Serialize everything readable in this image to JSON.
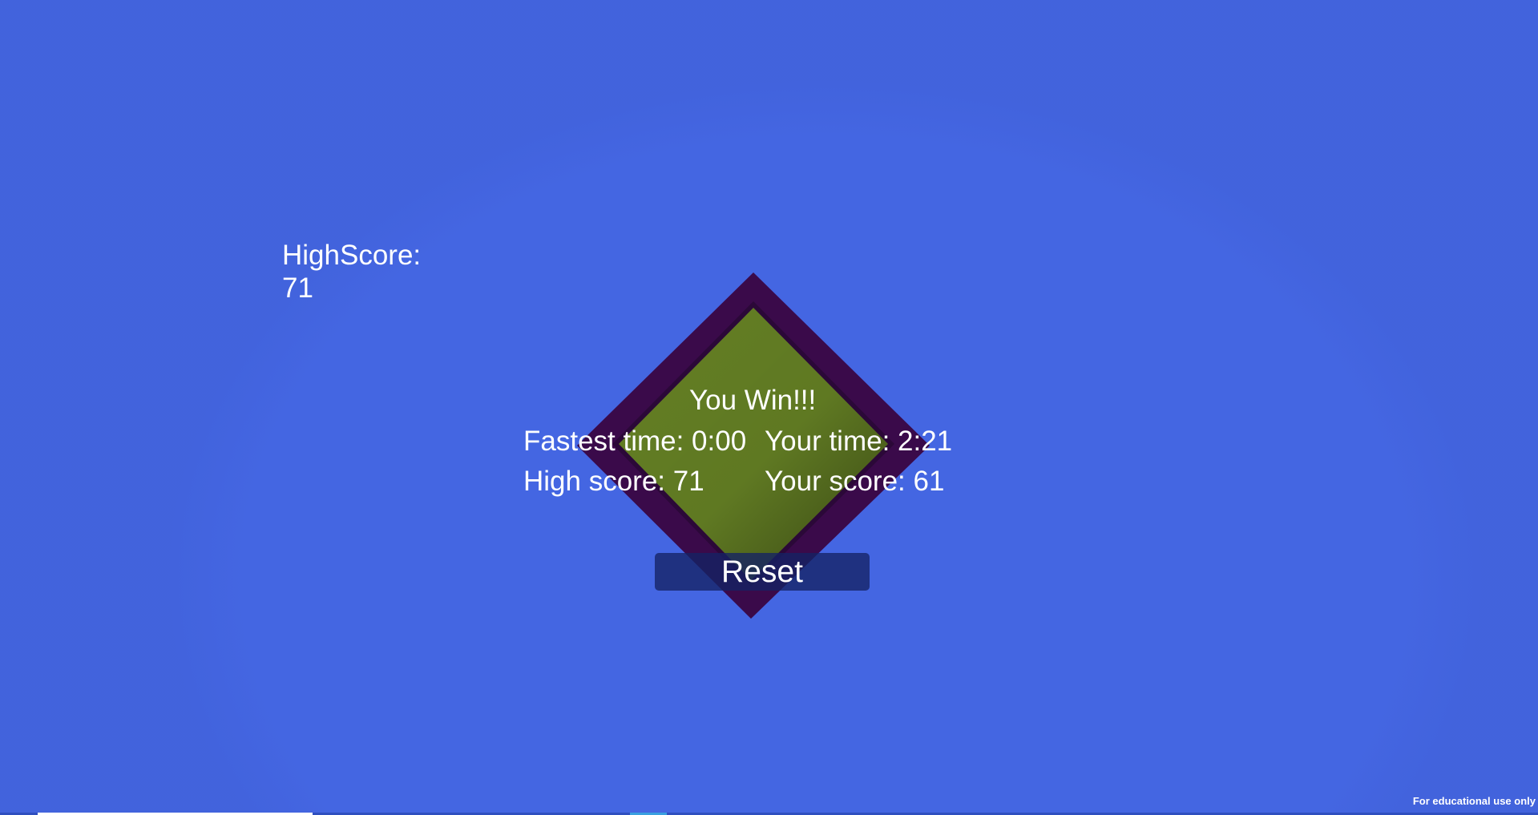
{
  "hud": {
    "highscore_label": "HighScore:",
    "highscore_value": "71"
  },
  "win_panel": {
    "title": "You Win!!!",
    "fastest_time": "Fastest time: 0:00",
    "your_time": "Your time: 2:21",
    "high_score": "High score: 71",
    "your_score": "Your score: 61"
  },
  "reset_button": {
    "label": "Reset"
  },
  "footer": {
    "note": "For educational use only"
  },
  "colors": {
    "background": "#4466e2",
    "board_frame": "#3a0a4a",
    "board_surface": "#647f24",
    "button": "#1a2a78"
  }
}
